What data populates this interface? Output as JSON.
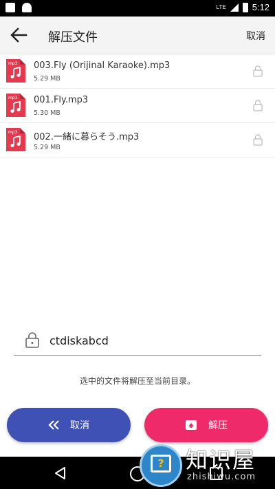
{
  "status_bar": {
    "network": "LTE",
    "time": "5:12"
  },
  "app_bar": {
    "title": "解压文件",
    "cancel_label": "取消"
  },
  "files": [
    {
      "name": "003.Fly (Orijinal Karaoke).mp3",
      "size": "5.29 MB",
      "icon_label": "mp3"
    },
    {
      "name": "001.Fly.mp3",
      "size": "5.30 MB",
      "icon_label": "mp3"
    },
    {
      "name": "002.一緒に暮らそう.mp3",
      "size": "5.29 MB",
      "icon_label": "mp3"
    }
  ],
  "password": {
    "value": "ctdiskabcd"
  },
  "hint": "选中的文件将解压至当前目录。",
  "buttons": {
    "cancel_label": "取消",
    "extract_label": "解压"
  },
  "watermark": {
    "name": "知识屋",
    "url": "zhishiwu.com"
  },
  "colors": {
    "cancel_button": "#3f51b5",
    "extract_button": "#ee2a6b",
    "file_icon": "#e53950"
  }
}
